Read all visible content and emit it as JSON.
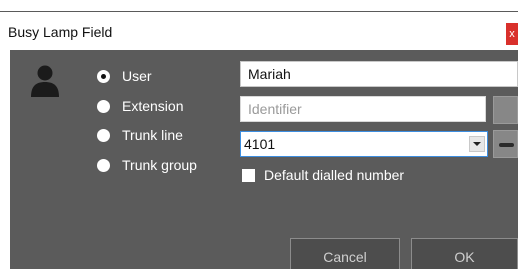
{
  "window": {
    "title": "Busy Lamp Field",
    "close_glyph": "x"
  },
  "icons": {
    "user": "user-icon",
    "dropdown": "chevron-down-icon",
    "remove": "minus-icon"
  },
  "target_type": {
    "options": [
      {
        "label": "User",
        "checked": true
      },
      {
        "label": "Extension",
        "checked": false
      },
      {
        "label": "Trunk line",
        "checked": false
      },
      {
        "label": "Trunk group",
        "checked": false
      }
    ]
  },
  "fields": {
    "name_value": "Mariah",
    "identifier_value": "",
    "identifier_placeholder": "Identifier",
    "number_value": "4101"
  },
  "default_dialled": {
    "label": "Default dialled number",
    "checked": false
  },
  "buttons": {
    "cancel": "Cancel",
    "ok": "OK"
  },
  "colors": {
    "dialog_background": "#5b5b5b",
    "close_button": "#d9302b",
    "focus_border": "#3d8ee0"
  }
}
